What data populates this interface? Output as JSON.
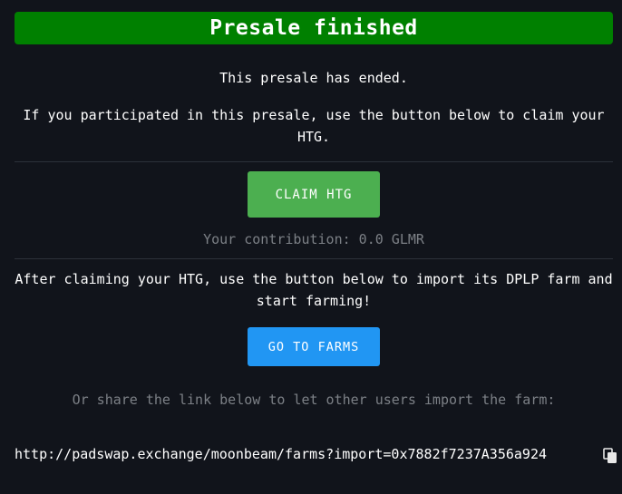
{
  "banner": {
    "title": "Presale finished"
  },
  "status": {
    "ended": "This presale has ended.",
    "claim_instructions": "If you participated in this presale, use the button below to claim your HTG."
  },
  "claim": {
    "button_label": "CLAIM HTG",
    "contribution": "Your contribution: 0.0 GLMR"
  },
  "farm": {
    "instructions": "After claiming your HTG, use the button below to import its DPLP farm and start farming!",
    "button_label": "GO TO FARMS"
  },
  "share": {
    "text": "Or share the link below to let other users import the farm:",
    "link": "http://padswap.exchange/moonbeam/farms?import=0x7882f7237A356a924",
    "copy_icon": "copy-icon"
  },
  "colors": {
    "background": "#11141b",
    "banner": "#008000",
    "claim_button": "#4caf50",
    "farms_button": "#2196f3",
    "muted_text": "#7c8086"
  }
}
